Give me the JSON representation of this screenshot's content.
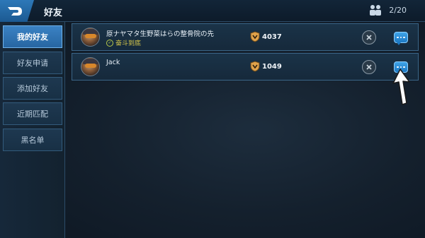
{
  "header": {
    "title": "好友",
    "friend_count": "2/20",
    "back_icon": "back-arrow-icon",
    "friends_icon": "friends-icon"
  },
  "sidebar": {
    "tabs": [
      {
        "label": "我的好友",
        "active": true
      },
      {
        "label": "好友申请",
        "active": false
      },
      {
        "label": "添加好友",
        "active": false
      },
      {
        "label": "近期匹配",
        "active": false
      },
      {
        "label": "黑名单",
        "active": false
      }
    ]
  },
  "friends": [
    {
      "name": "原ナヤマタ生野菜はらの整骨院の先",
      "status": "奋斗到底",
      "score": "4037",
      "rank_icon": "rank-badge-icon"
    },
    {
      "name": "Jack",
      "status": "",
      "score": "1049",
      "rank_icon": "rank-badge-icon"
    }
  ],
  "colors": {
    "accent": "#2d78b8",
    "active_tab": "#3b82c4",
    "status_text": "#d5c64a",
    "rank_gold": "#e0a24a"
  }
}
